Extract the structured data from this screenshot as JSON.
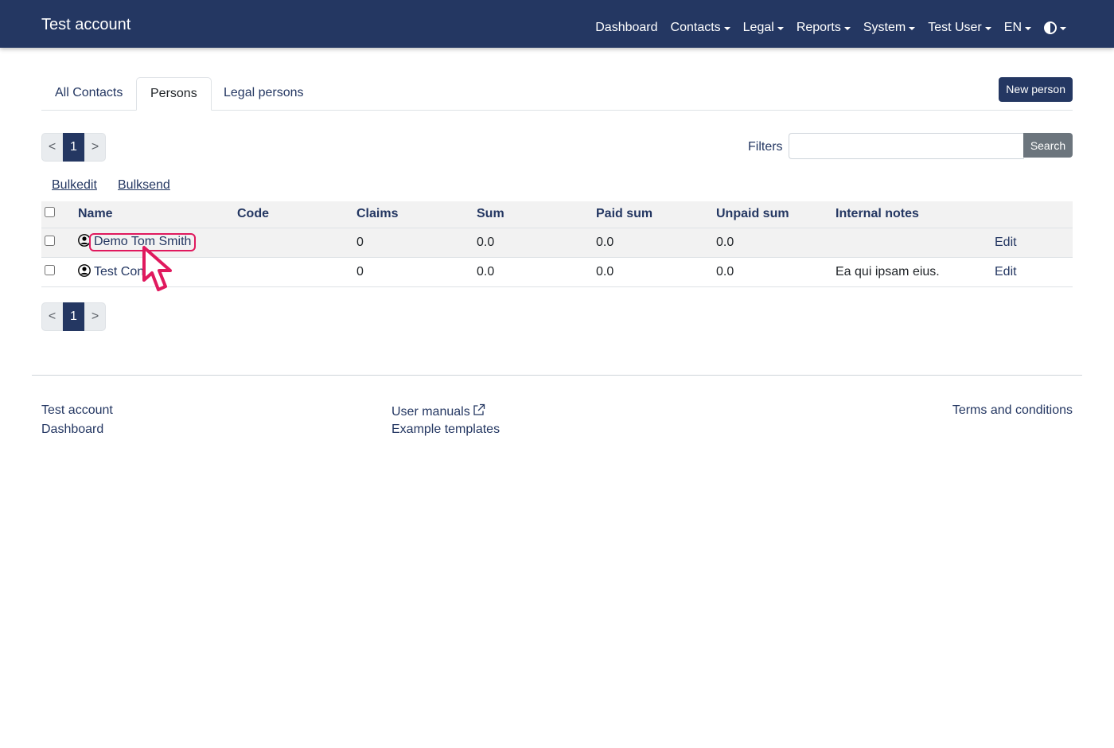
{
  "navbar": {
    "brand": "Test account",
    "items": [
      {
        "label": "Dashboard",
        "dropdown": false
      },
      {
        "label": "Contacts",
        "dropdown": true
      },
      {
        "label": "Legal",
        "dropdown": true
      },
      {
        "label": "Reports",
        "dropdown": true
      },
      {
        "label": "System",
        "dropdown": true
      },
      {
        "label": "Test User",
        "dropdown": true
      },
      {
        "label": "EN",
        "dropdown": true
      }
    ],
    "theme_icon": "contrast-icon"
  },
  "tabs": [
    {
      "label": "All Contacts",
      "active": false
    },
    {
      "label": "Persons",
      "active": true
    },
    {
      "label": "Legal persons",
      "active": false
    }
  ],
  "new_person_label": "New person",
  "pagination": {
    "prev": "<",
    "current": "1",
    "next": ">"
  },
  "filters": {
    "label": "Filters",
    "value": "",
    "placeholder": "",
    "search_label": "Search"
  },
  "bulk": {
    "edit": "Bulkedit",
    "send": "Bulksend"
  },
  "table": {
    "columns": [
      "Name",
      "Code",
      "Claims",
      "Sum",
      "Paid sum",
      "Unpaid sum",
      "Internal notes"
    ],
    "rows": [
      {
        "name": "Demo Tom Smith",
        "code": "",
        "claims": "0",
        "sum": "0.0",
        "paid_sum": "0.0",
        "unpaid_sum": "0.0",
        "notes": "",
        "edit": "Edit"
      },
      {
        "name": "Test Con",
        "code": "",
        "claims": "0",
        "sum": "0.0",
        "paid_sum": "0.0",
        "unpaid_sum": "0.0",
        "notes": "Ea qui ipsam eius.",
        "edit": "Edit"
      }
    ]
  },
  "footer": {
    "col1": [
      "Test account",
      "Dashboard"
    ],
    "col2": [
      "User manuals",
      "Example templates"
    ],
    "col3": [
      "Terms and conditions"
    ]
  },
  "colors": {
    "primary": "#243762",
    "highlight": "#e0195e",
    "search_button": "#6c757d"
  }
}
